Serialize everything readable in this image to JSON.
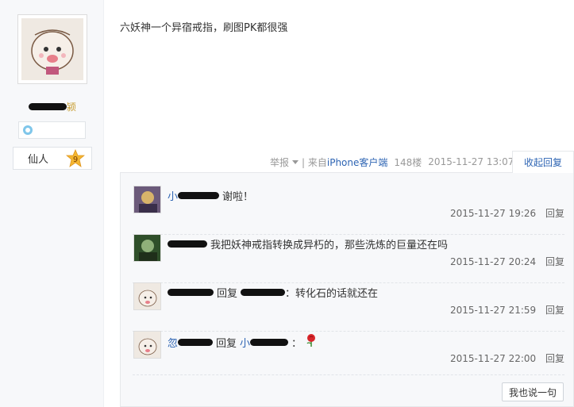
{
  "author": {
    "name_suffix": "颍",
    "level_name": "仙人",
    "level_number": "9"
  },
  "post": {
    "content": "六妖神一个异宿戒指，刷图PK都很强",
    "report_label": "举报",
    "source_prefix": "| 来自",
    "source_client": "iPhone客户端",
    "floor": "148楼",
    "time": "2015-11-27 13:07",
    "collapse_label": "收起回复"
  },
  "replies": [
    {
      "name_visible": "小",
      "mid": "",
      "target_visible": "",
      "text": "谢啦！",
      "time": "2015-11-27 19:26",
      "reply_label": "回复"
    },
    {
      "name_visible": "",
      "mid": "",
      "target_visible": "",
      "text": "我把妖神戒指转换成异朽的，那些洗炼的巨量还在吗",
      "time": "2015-11-27 20:24",
      "reply_label": "回复"
    },
    {
      "name_visible": "",
      "mid": "回复",
      "target_visible": "",
      "text": "：转化石的话就还在",
      "time": "2015-11-27 21:59",
      "reply_label": "回复"
    },
    {
      "name_visible": "忽",
      "mid": "回复",
      "target_visible": "小",
      "text": "：",
      "time": "2015-11-27 22:00",
      "reply_label": "回复"
    }
  ],
  "say_button": "我也说一句",
  "colors": {
    "link": "#2d64b3",
    "meta": "#999999",
    "panel_bg": "#f7f8fa",
    "username_gold": "#c69b2d",
    "level_star": "#f3b632"
  }
}
